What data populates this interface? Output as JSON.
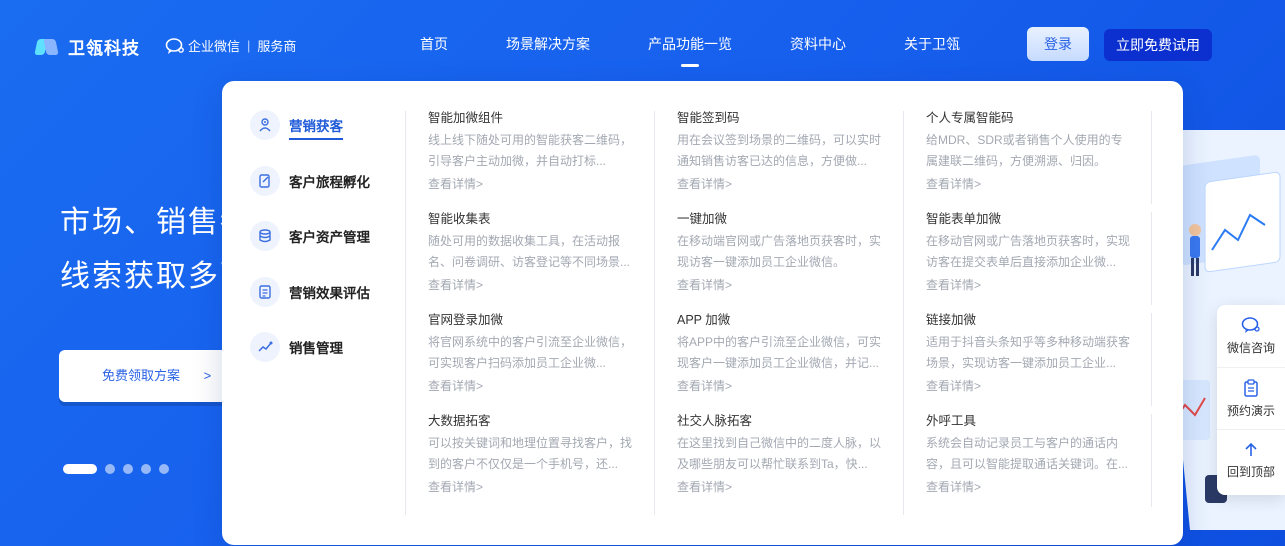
{
  "brand": {
    "name": "卫瓴科技",
    "wecom": "企业微信",
    "provider": "服务商"
  },
  "nav": {
    "items": [
      "首页",
      "场景解决方案",
      "产品功能一览",
      "资料中心",
      "关于卫瓴"
    ],
    "active": "产品功能一览"
  },
  "actions": {
    "login": "登录",
    "trial": "立即免费试用"
  },
  "hero": {
    "line1": "市场、销售都",
    "line2": "线索获取多而",
    "button": "免费领取方案",
    "button_arrow": ">"
  },
  "carousel": {
    "slides": 5,
    "active_index": 0
  },
  "menu": {
    "categories": [
      "营销获客",
      "客户旅程孵化",
      "客户资产管理",
      "营销效果评估",
      "销售管理"
    ],
    "active_category": "营销获客",
    "more_label": "查看详情>",
    "features": [
      {
        "title": "智能加微组件",
        "desc": "线上线下随处可用的智能获客二维码，引导客户主动加微，并自动打标..."
      },
      {
        "title": "智能签到码",
        "desc": "用在会议签到场景的二维码，可以实时通知销售访客已达的信息，方便做..."
      },
      {
        "title": "个人专属智能码",
        "desc": "给MDR、SDR或者销售个人使用的专属建联二维码，方便溯源、归因。"
      },
      {
        "title": "智能收集表",
        "desc": "随处可用的数据收集工具，在活动报名、问卷调研、访客登记等不同场景..."
      },
      {
        "title": "一键加微",
        "desc": "在移动端官网或广告落地页获客时，实现访客一键添加员工企业微信。"
      },
      {
        "title": "智能表单加微",
        "desc": "在移动官网或广告落地页获客时，实现访客在提交表单后直接添加企业微..."
      },
      {
        "title": "官网登录加微",
        "desc": "将官网系统中的客户引流至企业微信，可实现客户扫码添加员工企业微..."
      },
      {
        "title": "APP 加微",
        "desc": "将APP中的客户引流至企业微信，可实现客户一键添加员工企业微信，并记..."
      },
      {
        "title": "链接加微",
        "desc": "适用于抖音头条知乎等多种移动端获客场景，实现访客一键添加员工企业..."
      },
      {
        "title": "大数据拓客",
        "desc": "可以按关键词和地理位置寻找客户，找到的客户不仅仅是一个手机号，还..."
      },
      {
        "title": "社交人脉拓客",
        "desc": "在这里找到自己微信中的二度人脉，以及哪些朋友可以帮忙联系到Ta，快..."
      },
      {
        "title": "外呼工具",
        "desc": "系统会自动记录员工与客户的通话内容，且可以智能提取通话关键词。在..."
      }
    ]
  },
  "float": {
    "items": [
      "微信咨询",
      "预约演示",
      "回到顶部"
    ]
  },
  "colors": {
    "primary": "#1760ee",
    "accent": "#1f5bd8",
    "trial_button": "#0c2fcf"
  }
}
